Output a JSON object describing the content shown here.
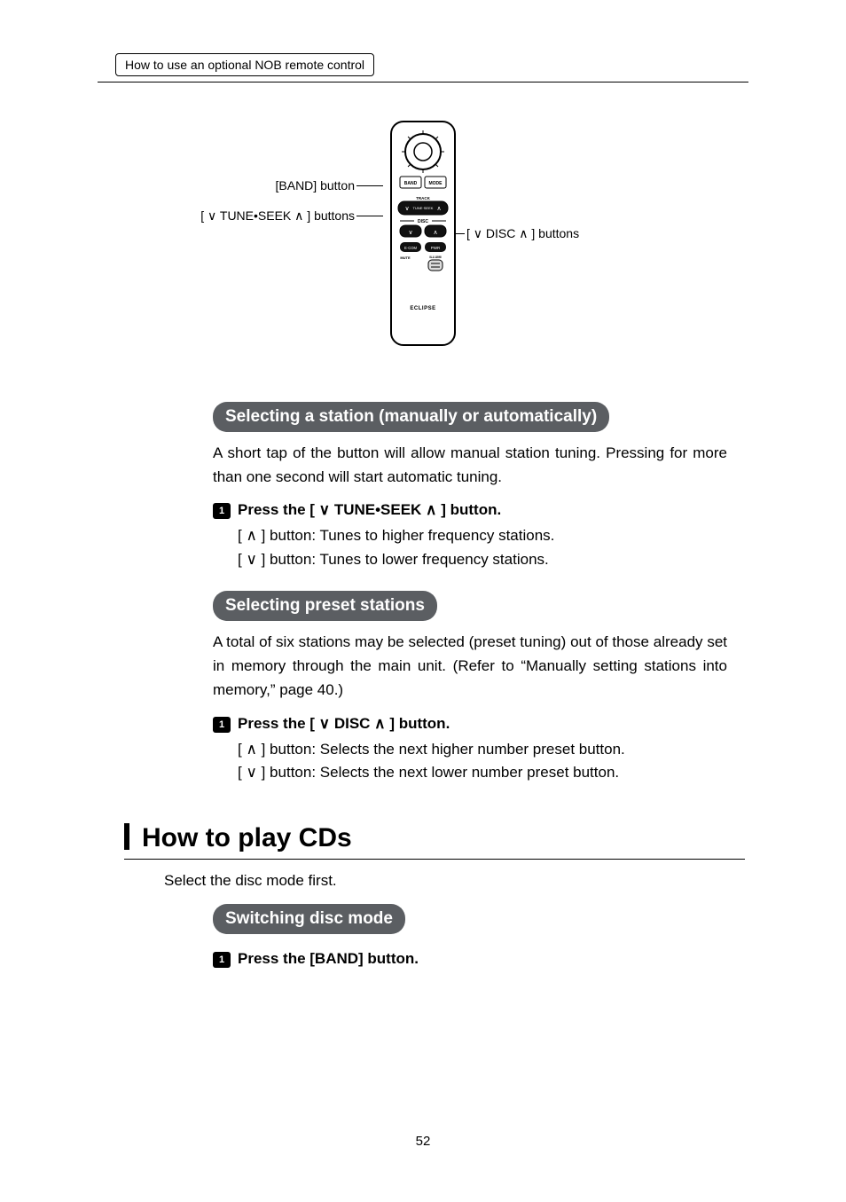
{
  "breadcrumb": "How to use an optional NOB remote control",
  "figure": {
    "label_band": "[BAND] button",
    "label_tune_seek": "[ ∨ TUNE•SEEK ∧ ] buttons",
    "label_disc": "[ ∨ DISC ∧ ] buttons"
  },
  "sec1": {
    "heading": "Selecting a station (manually or automatically)",
    "para": "A short tap of the button will allow manual station tuning. Pressing for more than one second will start automatic tuning.",
    "step_label": "Press the [ ∨ TUNE•SEEK ∧ ] button.",
    "line_up": "[ ∧ ] button:  Tunes to higher frequency stations.",
    "line_down": "[ ∨ ] button:  Tunes to lower frequency stations."
  },
  "sec2": {
    "heading": "Selecting preset stations",
    "para": "A total of six stations may be selected (preset tuning) out of those already set in memory through the main unit. (Refer to “Manually setting stations into memory,” page 40.)",
    "step_label": "Press the [ ∨ DISC ∧ ] button.",
    "line_up": "[ ∧ ] button:  Selects the next higher number preset button.",
    "line_down": "[ ∨ ] button:  Selects the next lower number preset button."
  },
  "h2": "How to play CDs",
  "intro": "Select the disc mode first.",
  "sec3": {
    "heading": "Switching disc mode",
    "step_label": "Press the [BAND] button."
  },
  "page_number": "52"
}
